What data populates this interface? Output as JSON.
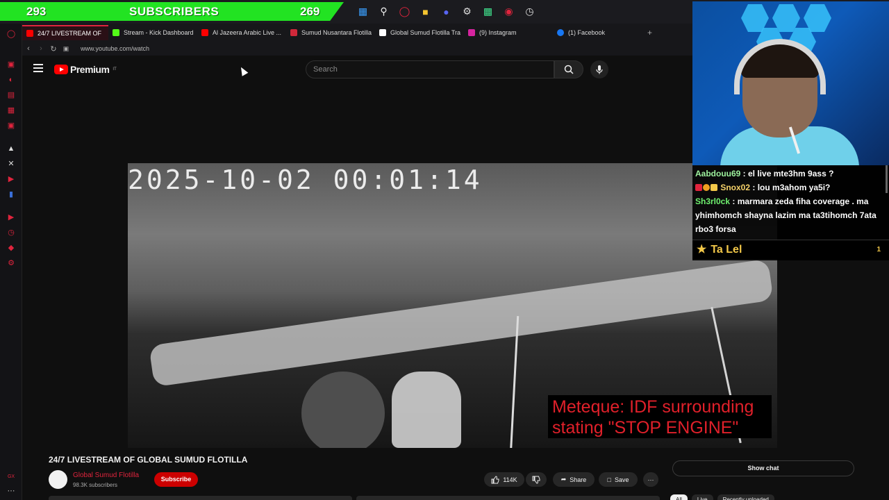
{
  "subscriber_banner": {
    "left_count": "293",
    "label": "SUBSCRIBERS",
    "right_count": "269"
  },
  "taskbar_icons": [
    "windows-icon",
    "search-icon",
    "opera-icon",
    "folder-icon",
    "discord-icon",
    "steam-icon",
    "terminal-icon",
    "location-icon",
    "clock-icon"
  ],
  "tabs": [
    {
      "label": "24/7 LIVESTREAM OF",
      "active": true,
      "color": "#e0243d"
    },
    {
      "label": "Stream - Kick Dashboard",
      "active": false,
      "color": "#53fc18"
    },
    {
      "label": "Al Jazeera Arabic Live ...",
      "active": false,
      "color": "#ff0000"
    },
    {
      "label": "Sumud Nusantara Flotilla",
      "active": false,
      "color": "#d0283a"
    },
    {
      "label": "Global Sumud Flotilla Tra",
      "active": false,
      "color": "#ffffff"
    },
    {
      "label": "(9) Instagram",
      "active": false,
      "color": "#d6249f"
    },
    {
      "label": "(1) Facebook",
      "active": false,
      "color": "#1877f2"
    }
  ],
  "new_tab": "+",
  "address": {
    "url": "www.youtube.com/watch"
  },
  "youtube": {
    "logo_text": "Premium",
    "logo_country": "IT",
    "search_placeholder": "Search"
  },
  "video": {
    "timestamp": "2025-10-02  00:01:14",
    "caption": "Meteque: IDF surrounding stating \"STOP ENGINE\""
  },
  "chat": {
    "messages": [
      {
        "user": "Aabdouu69",
        "text": " : el live mte3hm 9ass ?"
      },
      {
        "user": "Snox02",
        "text": " : lou m3ahom ya5i?"
      },
      {
        "user": "Sh3rl0ck",
        "text": " : marmara zeda fiha coverage . ma yhimhomch shayna lazim ma ta3tihomch 7ata rbo3 forsa"
      }
    ],
    "pinned_name": "Ta Lel",
    "pinned_count": "1"
  },
  "info": {
    "title": "24/7 LIVESTREAM OF GLOBAL SUMUD FLOTILLA",
    "channel": "Global Sumud Flotilla",
    "subscribers": "98.3K subscribers",
    "subscribe": "Subscribe",
    "likes": "114K",
    "share": "Share",
    "save": "Save",
    "more": "···",
    "show_chat": "Show chat",
    "chips": [
      "All",
      "Live",
      "Recently uploaded"
    ]
  },
  "colors": {
    "accent": "#e0243d",
    "banner_green": "#22e322",
    "youtube_red": "#ff0000"
  }
}
